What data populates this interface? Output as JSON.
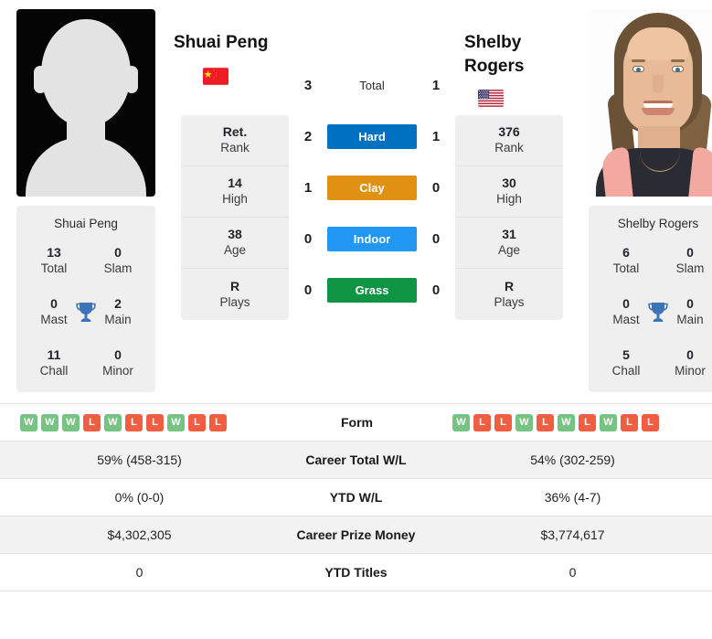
{
  "players": {
    "left": {
      "name": "Shuai Peng",
      "flag": "cn",
      "flag_name": "china-flag",
      "photo_type": "placeholder-silhouette",
      "card_name": "Shuai Peng",
      "titles": [
        {
          "value": "13",
          "label": "Total"
        },
        {
          "value": "0",
          "label": "Slam"
        },
        {
          "value": "0",
          "label": "Mast"
        },
        {
          "value": "2",
          "label": "Main"
        },
        {
          "value": "11",
          "label": "Chall"
        },
        {
          "value": "0",
          "label": "Minor"
        }
      ],
      "profile": [
        {
          "value": "Ret.",
          "label": "Rank"
        },
        {
          "value": "14",
          "label": "High"
        },
        {
          "value": "38",
          "label": "Age"
        },
        {
          "value": "R",
          "label": "Plays"
        }
      ],
      "form": [
        "W",
        "W",
        "W",
        "L",
        "W",
        "L",
        "L",
        "W",
        "L",
        "L"
      ],
      "career_total_wl": "59% (458-315)",
      "ytd_wl": "0% (0-0)",
      "career_prize_money": "$4,302,305",
      "ytd_titles": "0"
    },
    "right": {
      "name": "Shelby Rogers",
      "flag": "us",
      "flag_name": "usa-flag",
      "photo_type": "portrait",
      "card_name": "Shelby Rogers",
      "titles": [
        {
          "value": "6",
          "label": "Total"
        },
        {
          "value": "0",
          "label": "Slam"
        },
        {
          "value": "0",
          "label": "Mast"
        },
        {
          "value": "0",
          "label": "Main"
        },
        {
          "value": "5",
          "label": "Chall"
        },
        {
          "value": "0",
          "label": "Minor"
        }
      ],
      "profile": [
        {
          "value": "376",
          "label": "Rank"
        },
        {
          "value": "30",
          "label": "High"
        },
        {
          "value": "31",
          "label": "Age"
        },
        {
          "value": "R",
          "label": "Plays"
        }
      ],
      "form": [
        "W",
        "L",
        "L",
        "W",
        "L",
        "W",
        "L",
        "W",
        "L",
        "L"
      ],
      "career_total_wl": "54% (302-259)",
      "ytd_wl": "36% (4-7)",
      "career_prize_money": "$3,774,617",
      "ytd_titles": "0"
    }
  },
  "head_to_head": [
    {
      "left": "3",
      "label": "Total",
      "right": "1",
      "style": "plain",
      "color": ""
    },
    {
      "left": "2",
      "label": "Hard",
      "right": "1",
      "style": "badge",
      "color": "#0070c0"
    },
    {
      "left": "1",
      "label": "Clay",
      "right": "0",
      "style": "badge",
      "color": "#e09112"
    },
    {
      "left": "0",
      "label": "Indoor",
      "right": "0",
      "style": "badge",
      "color": "#2196f3"
    },
    {
      "left": "0",
      "label": "Grass",
      "right": "0",
      "style": "badge",
      "color": "#0e9442"
    }
  ],
  "table": {
    "rows": [
      {
        "label": "Form",
        "key": "form",
        "type": "badges"
      },
      {
        "label": "Career Total W/L",
        "key": "career_total_wl",
        "type": "text"
      },
      {
        "label": "YTD W/L",
        "key": "ytd_wl",
        "type": "text"
      },
      {
        "label": "Career Prize Money",
        "key": "career_prize_money",
        "type": "text"
      },
      {
        "label": "YTD Titles",
        "key": "ytd_titles",
        "type": "text"
      }
    ]
  },
  "colors": {
    "win_badge": "#77c383",
    "loss_badge": "#ef5d43",
    "card_bg": "#efefef",
    "trophy": "#3d74b8"
  }
}
